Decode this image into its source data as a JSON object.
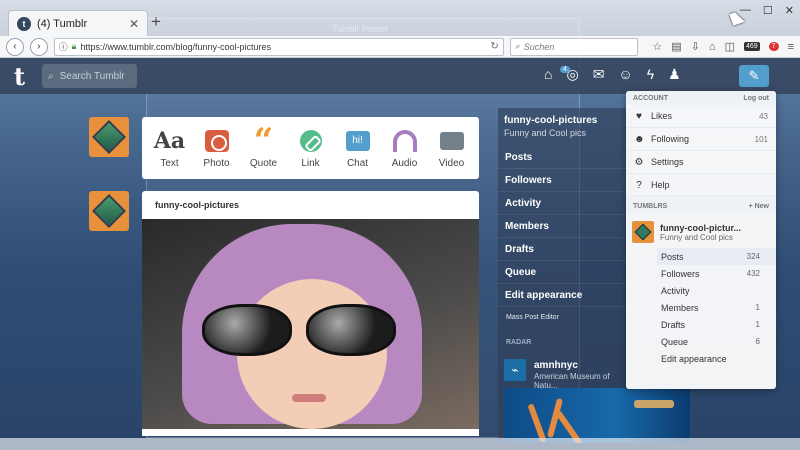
{
  "browser": {
    "tab_title": "(4) Tumblr",
    "tab_favicon": "t",
    "tab_close": "✕",
    "new_tab": "+",
    "minimize": "—",
    "maximize": "☐",
    "close": "✕",
    "back": "‹",
    "forward": "›",
    "url": "https://www.tumblr.com/blog/funny-cool-pictures",
    "search_placeholder": "Suchen",
    "ext_badge": "469",
    "notif_badge": "7"
  },
  "overlay_window_title": "Tumblr Poster",
  "tumblr_header": {
    "logo": "t",
    "search_placeholder": "Search Tumblr",
    "home_badge": "4",
    "icons": [
      "home-icon",
      "compass-icon",
      "mail-icon",
      "smiley-icon",
      "lightning-icon",
      "user-icon"
    ],
    "compose": "✎"
  },
  "composer": {
    "types": [
      {
        "label": "Text",
        "glyph": "Aa"
      },
      {
        "label": "Photo",
        "glyph": ""
      },
      {
        "label": "Quote",
        "glyph": "“"
      },
      {
        "label": "Link",
        "glyph": ""
      },
      {
        "label": "Chat",
        "glyph": "hi!"
      },
      {
        "label": "Audio",
        "glyph": ""
      },
      {
        "label": "Video",
        "glyph": ""
      }
    ]
  },
  "post": {
    "author": "funny-cool-pictures"
  },
  "sidebar": {
    "blog_title": "funny-cool-pictures",
    "blog_subtitle": "Funny and Cool pics",
    "nav": [
      "Posts",
      "Followers",
      "Activity",
      "Members",
      "Drafts",
      "Queue",
      "Edit appearance"
    ],
    "mass_post_editor": "Mass Post Editor",
    "radar_label": "RADAR",
    "radar_name": "amnhnyc",
    "radar_desc": "American Museum of Natu..."
  },
  "dropdown": {
    "account_label": "ACCOUNT",
    "logout": "Log out",
    "items": [
      {
        "label": "Likes",
        "count": "43",
        "icon": "heart-icon",
        "glyph": "♥"
      },
      {
        "label": "Following",
        "count": "101",
        "icon": "following-icon",
        "glyph": "☻"
      },
      {
        "label": "Settings",
        "count": "",
        "icon": "gear-icon",
        "glyph": "⚙"
      },
      {
        "label": "Help",
        "count": "",
        "icon": "help-icon",
        "glyph": "?"
      }
    ],
    "tumblrs_label": "TUMBLRS",
    "new_label": "+ New",
    "blog_name": "funny-cool-pictur...",
    "blog_desc": "Funny and Cool pics",
    "blog_sub": [
      {
        "label": "Posts",
        "count": "324"
      },
      {
        "label": "Followers",
        "count": "432"
      },
      {
        "label": "Activity",
        "count": ""
      },
      {
        "label": "Members",
        "count": "1"
      },
      {
        "label": "Drafts",
        "count": "1"
      },
      {
        "label": "Queue",
        "count": "6"
      },
      {
        "label": "Edit appearance",
        "count": ""
      }
    ]
  },
  "colors": {
    "tumblr_navy": "#36465d",
    "tumblr_blue": "#529ecc",
    "avatar_orange": "#e8913c"
  }
}
